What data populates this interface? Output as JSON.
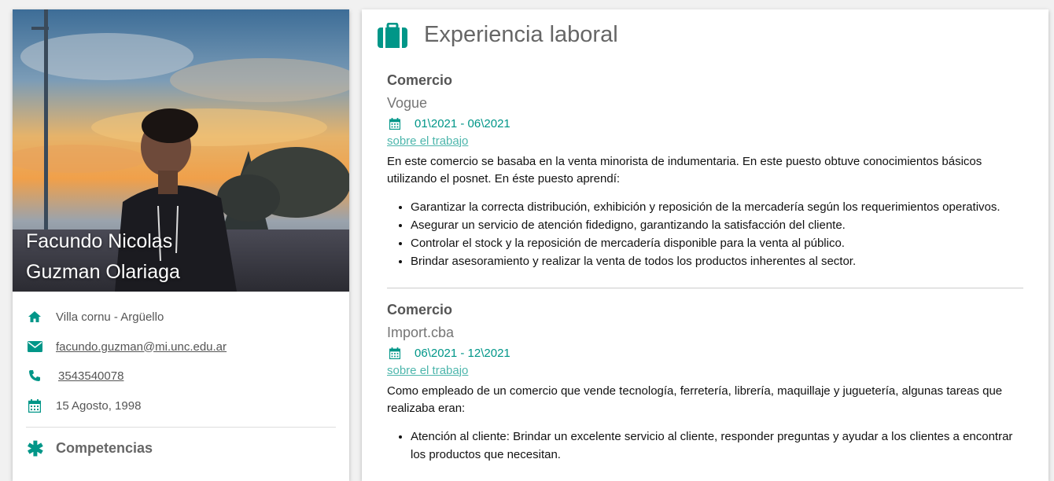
{
  "profile": {
    "name_line1": "Facundo Nicolas",
    "name_line2": "Guzman Olariaga",
    "location": "Villa cornu - Argüello",
    "email": "facundo.guzman@mi.unc.edu.ar",
    "phone": "3543540078",
    "birthdate": "15 Agosto, 1998",
    "skills_heading": "Competencias"
  },
  "experience": {
    "heading": "Experiencia laboral",
    "jobs": [
      {
        "category": "Comercio",
        "company": "Vogue",
        "dates": "01\\2021 - 06\\2021",
        "link": "sobre el trabajo",
        "description": "En este comercio se basaba en la venta minorista de indumentaria. En este puesto obtuve conocimientos básicos utilizando el posnet. En éste puesto aprendí:",
        "tasks": [
          "Garantizar la correcta distribución, exhibición y reposición de la mercadería según los requerimientos operativos.",
          "Asegurar un servicio de atención fidedigno, garantizando la satisfacción del cliente.",
          "Controlar el stock y la reposición de mercadería disponible para la venta al público.",
          "Brindar asesoramiento y realizar la venta de todos los productos inherentes al sector."
        ]
      },
      {
        "category": "Comercio",
        "company": "Import.cba",
        "dates": "06\\2021 - 12\\2021",
        "link": "sobre el trabajo",
        "description": "Como empleado de un comercio que vende tecnología, ferretería, librería, maquillaje y juguetería, algunas tareas que realizaba eran:",
        "tasks": [
          "Atención al cliente: Brindar un excelente servicio al cliente, responder preguntas y ayudar a los clientes a encontrar los productos que necesitan."
        ]
      }
    ]
  },
  "colors": {
    "accent": "#009688",
    "link": "#4db6ac"
  },
  "icons": [
    "home-icon",
    "envelope-icon",
    "phone-icon",
    "calendar-icon",
    "asterisk-icon",
    "briefcase-icon"
  ]
}
